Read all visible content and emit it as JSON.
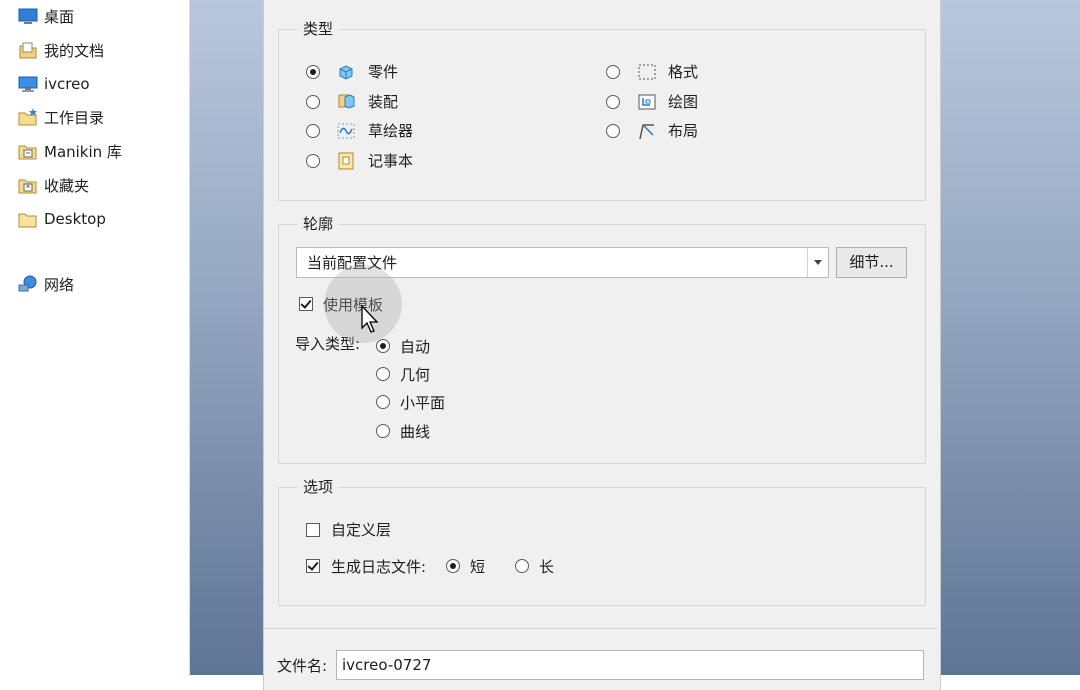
{
  "nav": {
    "items": [
      {
        "label": "桌面",
        "icon": "desktop-icon"
      },
      {
        "label": "我的文档",
        "icon": "documents-icon"
      },
      {
        "label": "ivcreo",
        "icon": "computer-icon"
      },
      {
        "label": "工作目录",
        "icon": "working-directory-icon"
      },
      {
        "label": "Manikin 库",
        "icon": "library-icon"
      },
      {
        "label": "收藏夹",
        "icon": "favorites-icon"
      },
      {
        "label": "Desktop",
        "icon": "folder-icon"
      },
      {
        "label": "网络",
        "icon": "network-icon"
      }
    ]
  },
  "dialog": {
    "type_group": {
      "title": "类型",
      "options": [
        {
          "label": "零件",
          "icon": "part-icon",
          "selected": true
        },
        {
          "label": "装配",
          "icon": "assembly-icon",
          "selected": false
        },
        {
          "label": "草绘器",
          "icon": "sketch-icon",
          "selected": false
        },
        {
          "label": "记事本",
          "icon": "notebook-icon",
          "selected": false
        },
        {
          "label": "格式",
          "icon": "format-icon",
          "selected": false
        },
        {
          "label": "绘图",
          "icon": "drawing-icon",
          "selected": false
        },
        {
          "label": "布局",
          "icon": "layout-icon",
          "selected": false
        }
      ]
    },
    "profile_group": {
      "title": "轮廓",
      "profile_value": "当前配置文件",
      "details_button": "细节...",
      "use_template_label": "使用模板",
      "use_template_checked": true,
      "import_type_label": "导入类型:",
      "import_options": [
        {
          "label": "自动",
          "selected": true
        },
        {
          "label": "几何",
          "selected": false
        },
        {
          "label": "小平面",
          "selected": false
        },
        {
          "label": "曲线",
          "selected": false
        }
      ]
    },
    "options_group": {
      "title": "选项",
      "custom_layer_label": "自定义层",
      "custom_layer_checked": false,
      "log_file_label": "生成日志文件:",
      "log_file_checked": true,
      "log_short_label": "短",
      "log_long_label": "长",
      "log_length": "短"
    },
    "filename_label": "文件名:",
    "filename_value": "ivcreo-0727"
  }
}
